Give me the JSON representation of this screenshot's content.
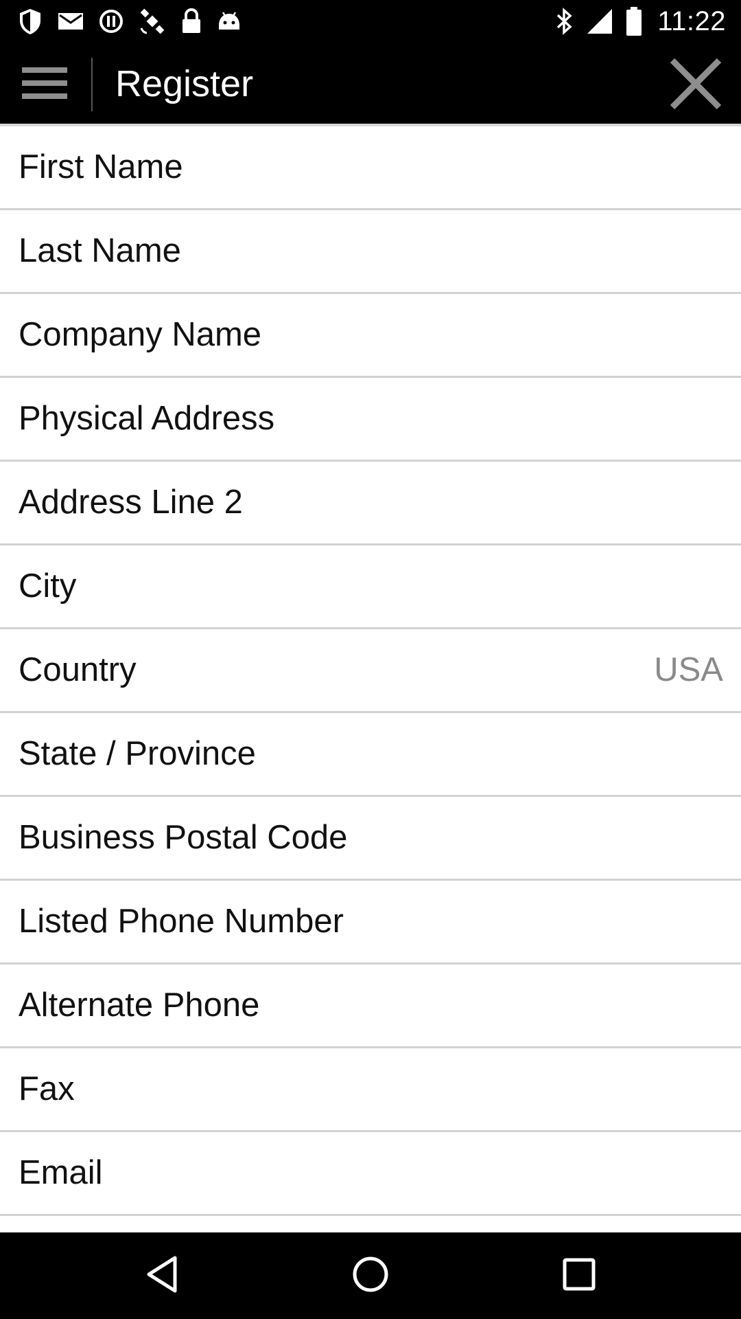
{
  "status_bar": {
    "time": "11:22",
    "icons": [
      "shield-icon",
      "mail-icon",
      "sync-icon",
      "satellite-icon",
      "lock-icon",
      "android-icon",
      "bluetooth-icon",
      "signal-icon",
      "battery-icon"
    ]
  },
  "app_bar": {
    "title": "Register",
    "menu_icon": "menu-icon",
    "close_icon": "close-icon"
  },
  "form": {
    "fields": [
      {
        "label": "First Name",
        "value": ""
      },
      {
        "label": "Last Name",
        "value": ""
      },
      {
        "label": "Company Name",
        "value": ""
      },
      {
        "label": "Physical Address",
        "value": ""
      },
      {
        "label": "Address Line 2",
        "value": ""
      },
      {
        "label": "City",
        "value": ""
      },
      {
        "label": "Country",
        "value": "USA"
      },
      {
        "label": "State / Province",
        "value": ""
      },
      {
        "label": "Business Postal Code",
        "value": ""
      },
      {
        "label": "Listed Phone Number",
        "value": ""
      },
      {
        "label": "Alternate Phone",
        "value": ""
      },
      {
        "label": "Fax",
        "value": ""
      },
      {
        "label": "Email",
        "value": ""
      }
    ]
  },
  "nav_bar": {
    "icons": [
      "back-icon",
      "home-icon",
      "recents-icon"
    ]
  },
  "colors": {
    "background": "#000000",
    "form_background": "#ffffff",
    "divider": "#d2d2d2",
    "value_text": "#8a8a8a"
  }
}
